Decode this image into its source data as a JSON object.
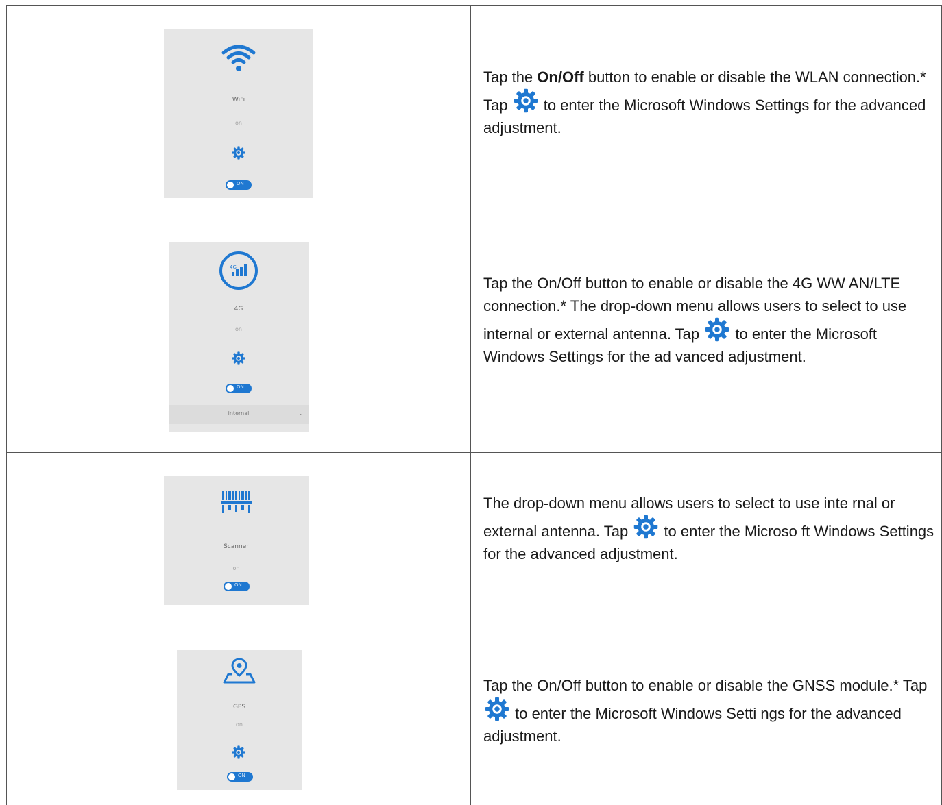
{
  "rows": [
    {
      "panel": {
        "name": "WiFi",
        "state": "on",
        "toggle": "ON"
      },
      "desc": {
        "p1": "Tap the ",
        "b1": "On",
        "p2": "/",
        "b2": "Off",
        "p3": " button to enable or disable the WLAN connection.* Tap ",
        "p4": " to enter the Microsoft Windows Settings for the advanced adjustment."
      }
    },
    {
      "panel": {
        "name": "4G",
        "state": "on",
        "toggle": "ON",
        "dropdown": "internal"
      },
      "desc": {
        "p1": "Tap the On/Off button to enable or disable the 4G WW AN/LTE connection.* The drop-down menu allows users to select to use internal or external antenna. Tap ",
        "p2": " to enter the Microsoft Windows Settings for the ad vanced adjustment."
      }
    },
    {
      "panel": {
        "name": "Scanner",
        "state": "on",
        "toggle": "ON"
      },
      "desc": {
        "p1": "The drop-down menu allows users to select to use inte rnal or external antenna. Tap ",
        "p2": " to enter the Microso ft Windows Settings for the advanced adjustment."
      }
    },
    {
      "panel": {
        "name": "GPS",
        "state": "on",
        "toggle": "ON"
      },
      "desc": {
        "p1": "Tap the On/Off button to enable or disable the GNSS module.* Tap ",
        "p2": " to enter the Microsoft Windows Setti ngs for the advanced adjustment."
      }
    }
  ],
  "colors": {
    "accent": "#1f78d1",
    "panel_bg": "#e6e6e6",
    "border": "#555555"
  },
  "icons": [
    "wifi-icon",
    "cellular-signal-icon",
    "barcode-icon",
    "location-map-icon",
    "gear-icon"
  ]
}
